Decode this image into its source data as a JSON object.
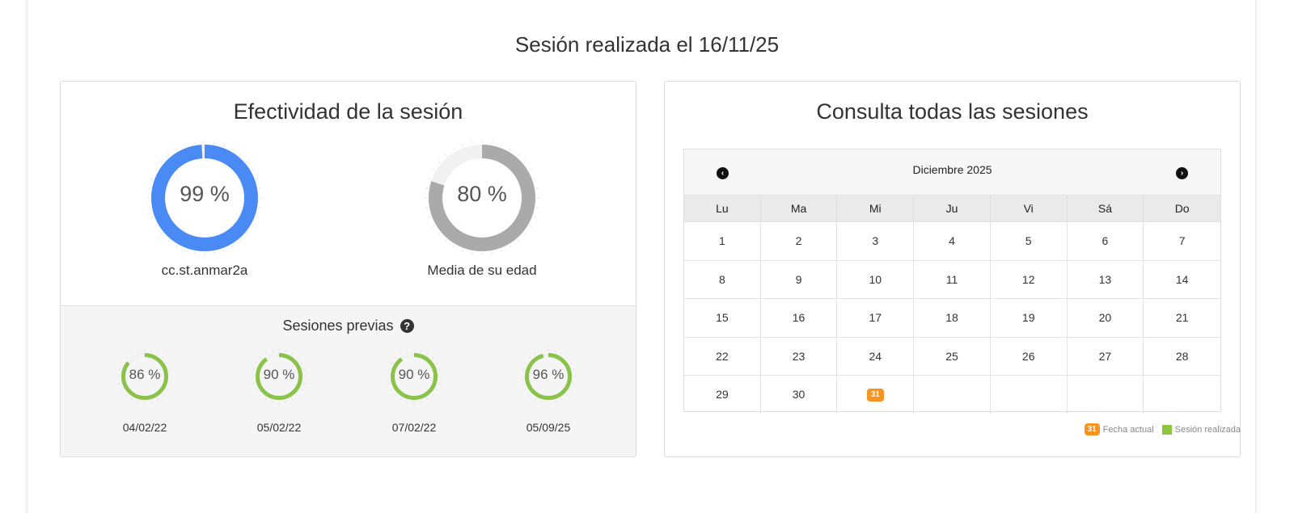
{
  "page": {
    "title": "Sesión realizada el 16/11/25"
  },
  "effectiveness": {
    "heading": "Efectividad de la sesión",
    "gauges": [
      {
        "value": 99,
        "display": "99 %",
        "label": "cc.st.anmar2a",
        "color": "#4a8af4"
      },
      {
        "value": 80,
        "display": "80 %",
        "label": "Media de su edad",
        "color": "#aaaaaa"
      }
    ],
    "previous": {
      "title": "Sesiones previas",
      "help_icon": "question-circle-icon",
      "sessions": [
        {
          "value": 86,
          "display": "86 %",
          "date": "04/02/22"
        },
        {
          "value": 90,
          "display": "90 %",
          "date": "05/02/22"
        },
        {
          "value": 90,
          "display": "90 %",
          "date": "07/02/22"
        },
        {
          "value": 96,
          "display": "96 %",
          "date": "05/09/25"
        }
      ],
      "color": "#8bc34a"
    }
  },
  "calendar_panel": {
    "heading": "Consulta todas las sesiones",
    "month": "Diciembre 2025",
    "prev_icon": "chevron-left-circle-icon",
    "next_icon": "chevron-right-circle-icon",
    "day_names": [
      "Lu",
      "Ma",
      "Mi",
      "Ju",
      "Vi",
      "Sá",
      "Do"
    ],
    "weeks": [
      [
        "1",
        "2",
        "3",
        "4",
        "5",
        "6",
        "7"
      ],
      [
        "8",
        "9",
        "10",
        "11",
        "12",
        "13",
        "14"
      ],
      [
        "15",
        "16",
        "17",
        "18",
        "19",
        "20",
        "21"
      ],
      [
        "22",
        "23",
        "24",
        "25",
        "26",
        "27",
        "28"
      ],
      [
        "29",
        "30",
        "31",
        "",
        "",
        "",
        ""
      ]
    ],
    "today": "31",
    "legend": {
      "today_badge": "31",
      "today_label": "Fecha actual",
      "done_label": "Sesión realizada",
      "today_color": "#f7931e",
      "done_color": "#8cc63f"
    }
  }
}
